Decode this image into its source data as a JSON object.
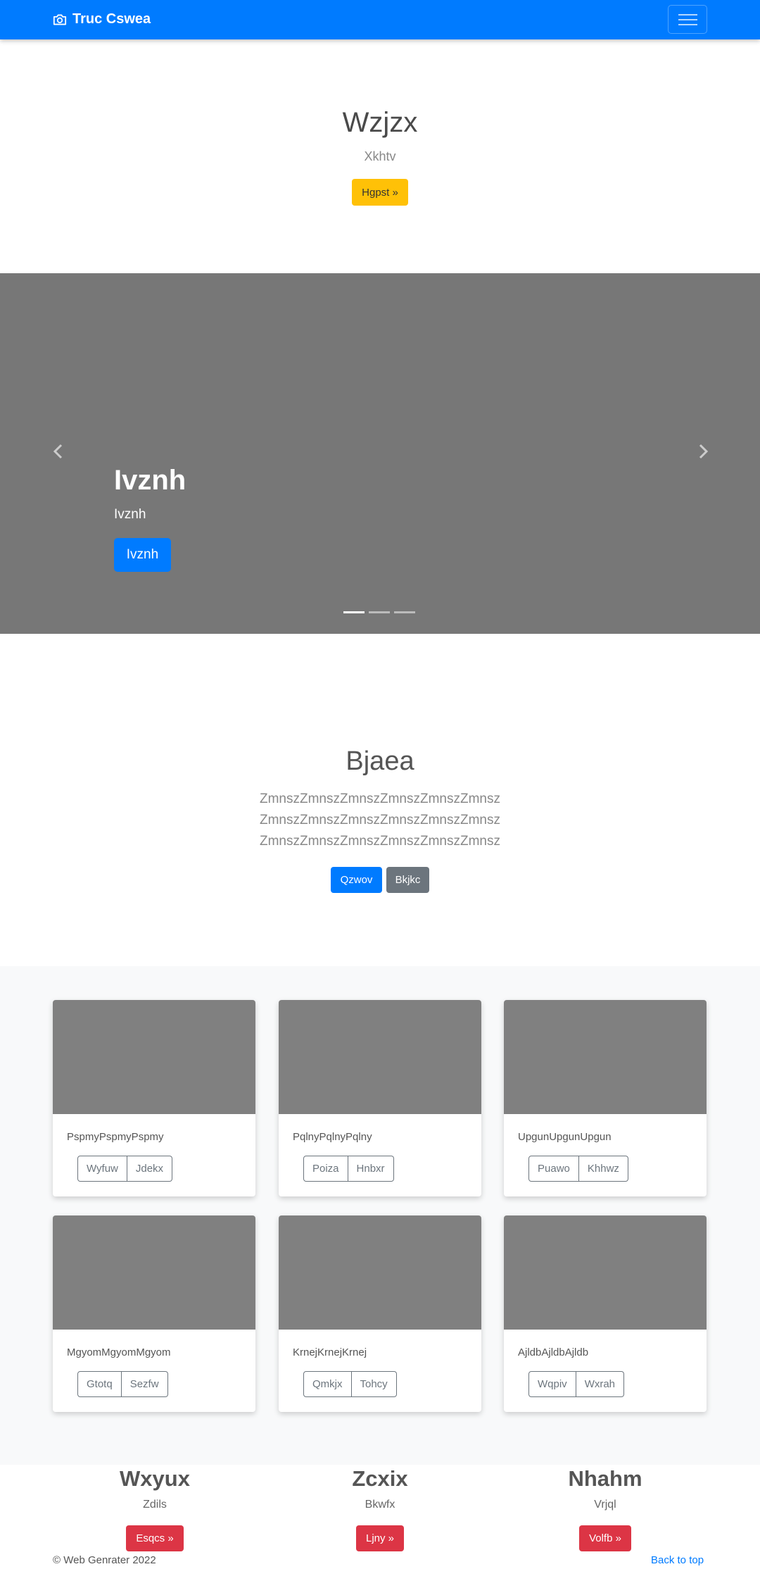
{
  "navbar": {
    "brand": "Truc Cswea",
    "colors": {
      "bg": "#007bff"
    }
  },
  "hero": {
    "title": "Wzjzx",
    "subtitle": "Xkhtv",
    "button": "Hgpst »"
  },
  "carousel": {
    "title": "Ivznh",
    "subtitle": "Ivznh",
    "button": "Ivznh",
    "slides": 3,
    "active": 0
  },
  "section": {
    "title": "Bjaea",
    "lines": [
      "ZmnszZmnszZmnszZmnszZmnszZmnsz",
      "ZmnszZmnszZmnszZmnszZmnszZmnsz",
      "ZmnszZmnszZmnszZmnszZmnszZmnsz"
    ],
    "primary": "Qzwov",
    "secondary": "Bkjkc"
  },
  "cards": [
    {
      "text": "PspmyPspmyPspmy",
      "btn1": "Wyfuw",
      "btn2": "Jdekx"
    },
    {
      "text": "PqlnyPqlnyPqlny",
      "btn1": "Poiza",
      "btn2": "Hnbxr"
    },
    {
      "text": "UpgunUpgunUpgun",
      "btn1": "Puawo",
      "btn2": "Khhwz"
    },
    {
      "text": "MgyomMgyomMgyom",
      "btn1": "Gtotq",
      "btn2": "Sezfw"
    },
    {
      "text": "KrnejKrnejKrnej",
      "btn1": "Qmkjx",
      "btn2": "Tohcy"
    },
    {
      "text": "AjldbAjldbAjldb",
      "btn1": "Wqpiv",
      "btn2": "Wxrah"
    }
  ],
  "columns": [
    {
      "heading": "Wxyux",
      "sub": "Zdils",
      "button": "Esqcs »"
    },
    {
      "heading": "Zcxix",
      "sub": "Bkwfx",
      "button": "Ljny »"
    },
    {
      "heading": "Nhahm",
      "sub": "Vrjql",
      "button": "Volfb »"
    }
  ],
  "footer": {
    "copyright": "© Web Genrater 2022",
    "back_to_top": "Back to top"
  }
}
